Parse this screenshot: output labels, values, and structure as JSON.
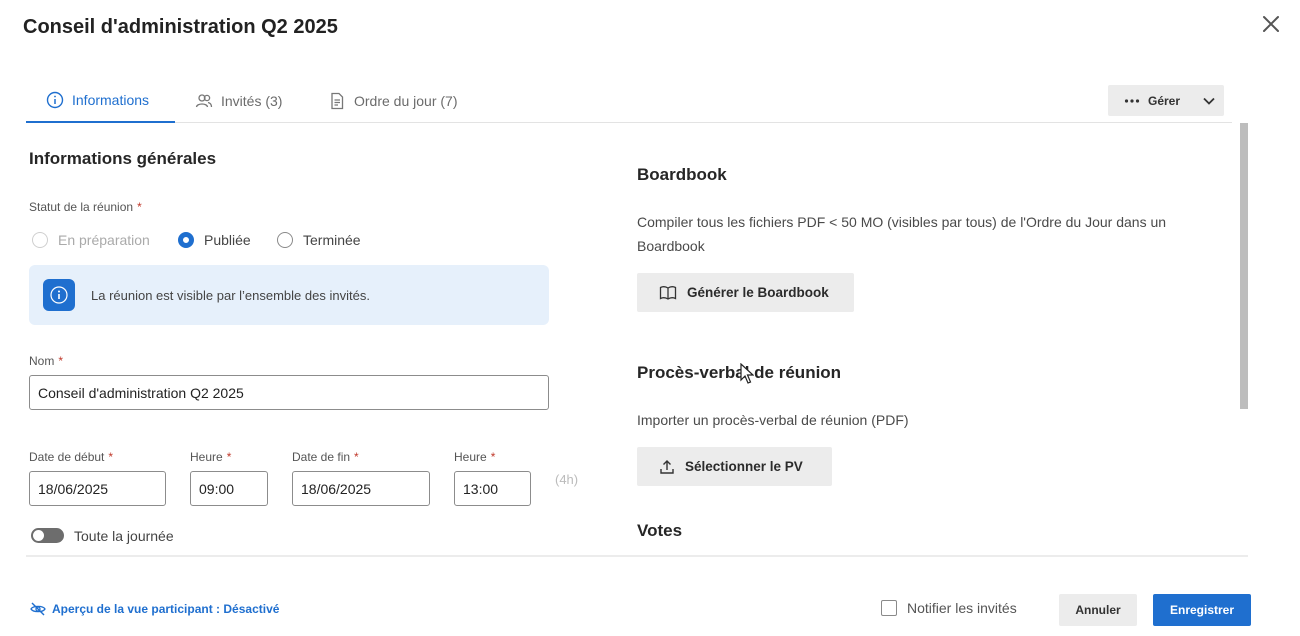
{
  "dialog": {
    "title": "Conseil d'administration Q2 2025"
  },
  "tabs": [
    {
      "label": "Informations",
      "icon": "info-circle-icon",
      "active": true
    },
    {
      "label": "Invités (3)",
      "icon": "users-icon",
      "active": false
    },
    {
      "label": "Ordre du jour (7)",
      "icon": "document-icon",
      "active": false
    }
  ],
  "manage": {
    "label": "Gérer",
    "icon": "more-dots-icon"
  },
  "general": {
    "title": "Informations générales",
    "status_label": "Statut de la réunion",
    "required_mark": "*",
    "status_options": [
      {
        "label": "En préparation",
        "state": "disabled"
      },
      {
        "label": "Publiée",
        "state": "checked"
      },
      {
        "label": "Terminée",
        "state": "unchecked"
      }
    ],
    "info_message": "La réunion est visible par l’ensemble des invités.",
    "name_label": "Nom",
    "name_value": "Conseil d'administration Q2 2025",
    "start_date_label": "Date de début",
    "start_date_value": "18/06/2025",
    "start_time_label": "Heure",
    "start_time_value": "09:00",
    "end_date_label": "Date de fin",
    "end_date_value": "18/06/2025",
    "end_time_label": "Heure",
    "end_time_value": "13:00",
    "duration": "(4h)",
    "all_day_label": "Toute la journée",
    "all_day_on": false
  },
  "boardbook": {
    "title": "Boardbook",
    "description": "Compiler tous les fichiers PDF < 50 MO (visibles par tous) de l'Ordre du Jour dans un Boardbook",
    "button_label": "Générer le Boardbook"
  },
  "minutes": {
    "title": "Procès-verbal de réunion",
    "description": "Importer un procès-verbal de réunion (PDF)",
    "button_label": "Sélectionner le PV"
  },
  "votes": {
    "title": "Votes"
  },
  "footer": {
    "preview_label": "Aperçu de la vue participant : Désactivé",
    "notify_label": "Notifier les invités",
    "cancel_label": "Annuler",
    "save_label": "Enregistrer"
  },
  "colors": {
    "accent": "#1f6fcf",
    "info_bg": "#e6f0fb",
    "button_gray": "#ececec",
    "required": "#c0392b"
  }
}
